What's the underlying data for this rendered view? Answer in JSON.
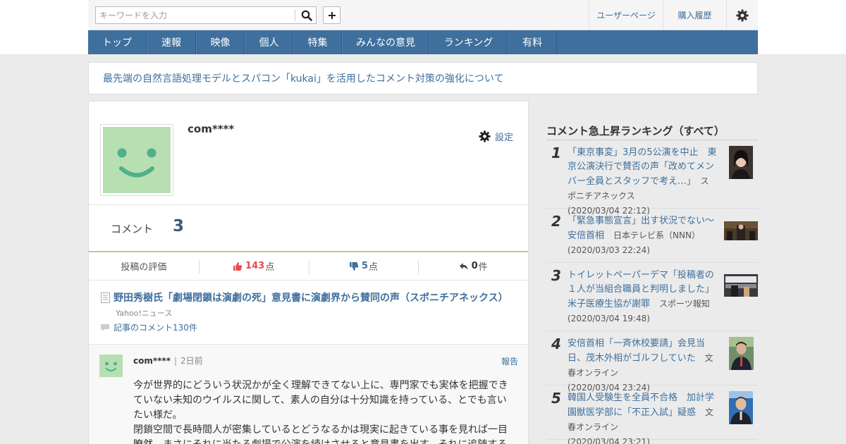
{
  "header": {
    "search_placeholder": "キーワードを入力",
    "user_page": "ユーザーページ",
    "purchase_history": "購入履歴"
  },
  "nav": {
    "items": [
      {
        "label": "トップ"
      },
      {
        "label": "速報"
      },
      {
        "label": "映像"
      },
      {
        "label": "個人"
      },
      {
        "label": "特集"
      },
      {
        "label": "みんなの意見"
      },
      {
        "label": "ランキング"
      },
      {
        "label": "有料"
      }
    ]
  },
  "notice": {
    "text": "最先端の自然言語処理モデルとスパコン「kukai」を活用したコメント対策の強化について"
  },
  "profile": {
    "username": "com****",
    "settings_label": "設定",
    "comment_label": "コメント",
    "comment_count": "3",
    "eval_label": "投稿の評価",
    "likes": "143",
    "likes_unit": "点",
    "dislikes": "5",
    "dislikes_unit": "点",
    "replies": "0",
    "replies_unit": "件"
  },
  "article": {
    "title": "野田秀樹氏「劇場閉鎖は演劇の死」意見書に演劇界から賛同の声（スポニチアネックス）",
    "source": "Yahoo!ニュース",
    "comments_link": "記事のコメント130件"
  },
  "comment": {
    "user": "com****",
    "ago": "2日前",
    "report": "報告",
    "para1": "今が世界的にどういう状況かが全く理解できてない上に、専門家でも実体を把握できていない未知のウイルスに関して、素人の自分は十分知識を持っている、とでも言いたい様だ。",
    "para2": "閉鎖空間で長時間人が密集しているとどうなるかは現実に起きている事を見れば一目瞭然。まさにそれに当たる劇場で公演を続けさせると意見書を出す。それに追随する"
  },
  "sidebar": {
    "title": "コメント急上昇ランキング（すべて）",
    "items": [
      {
        "rank": "1",
        "title": "「東京事変」3月の5公演を中止　東京公演決行で賛否の声「改めてメンバー全員とスタッフで考え…」",
        "source": "スポニチアネックス",
        "date": "(2020/03/04 22:12)"
      },
      {
        "rank": "2",
        "title": "「緊急事態宣言」出す状況でない～安倍首相",
        "source": "日本テレビ系（NNN）",
        "date": "(2020/03/03 22:24)"
      },
      {
        "rank": "3",
        "title": "トイレットペーパーデマ「投稿者の１人が当組合職員と判明しました」米子医療生協が謝罪",
        "source": "スポーツ報知",
        "date": "(2020/03/04 19:48)"
      },
      {
        "rank": "4",
        "title": "安倍首相「一斉休校要請」会見当日、茂木外相がゴルフしていた",
        "source": "文春オンライン",
        "date": "(2020/03/04 23:24)"
      },
      {
        "rank": "5",
        "title": "韓国人受験生を全員不合格　加計学園獣医学部に「不正入試」疑惑",
        "source": "文春オンライン",
        "date": "(2020/03/04 23:21)"
      }
    ]
  },
  "colors": {
    "accent": "#3f6f9c",
    "like": "#e8474c",
    "dislike": "#3f6f9c",
    "avatar": "#b7dfb2"
  }
}
